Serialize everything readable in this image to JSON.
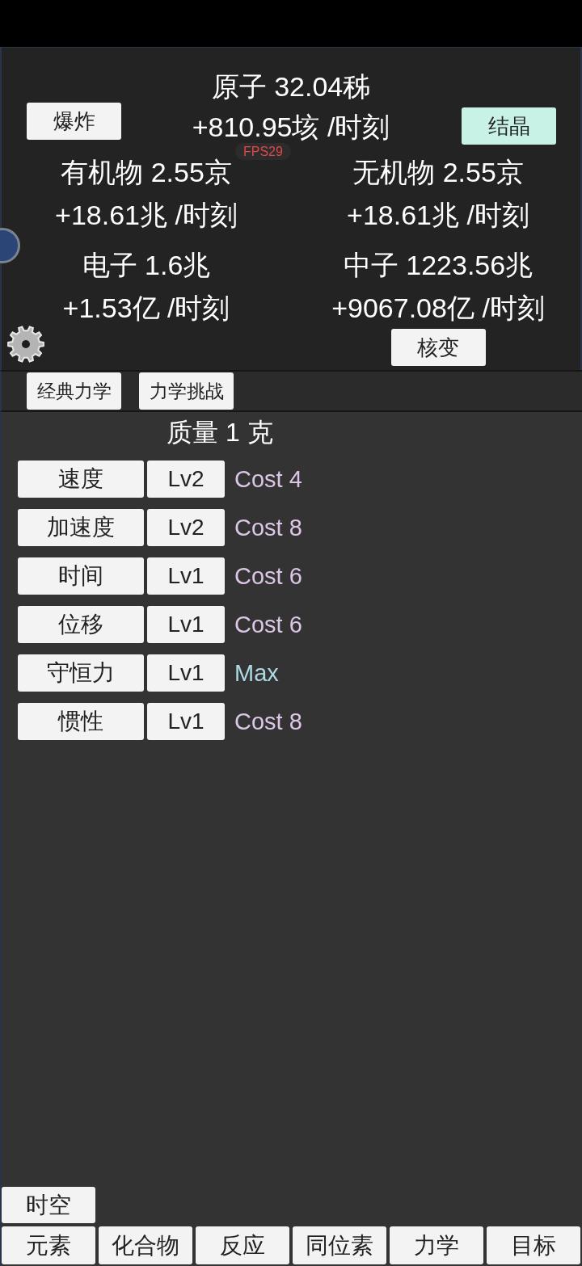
{
  "top_panel": {
    "explode_button": "爆炸",
    "atom": {
      "amount": "原子 32.04秭",
      "rate": "+810.95垓 /时刻"
    },
    "crystal_button": "结晶",
    "fps_counter": "FPS29",
    "resources": [
      {
        "amount": "有机物 2.55京",
        "rate": "+18.61兆 /时刻"
      },
      {
        "amount": "无机物 2.55京",
        "rate": "+18.61兆 /时刻"
      },
      {
        "amount": "电子 1.6兆",
        "rate": "+1.53亿 /时刻"
      },
      {
        "amount": "中子 1223.56兆",
        "rate": "+9067.08亿 /时刻"
      }
    ],
    "fission_button": "核变"
  },
  "subtabs": [
    {
      "label": "经典力学"
    },
    {
      "label": "力学挑战"
    }
  ],
  "mass_title": "质量 1 克",
  "upgrades": [
    {
      "name": "速度",
      "level": "Lv2",
      "kind": "cost",
      "price": "Cost 4"
    },
    {
      "name": "加速度",
      "level": "Lv2",
      "kind": "cost",
      "price": "Cost 8"
    },
    {
      "name": "时间",
      "level": "Lv1",
      "kind": "cost",
      "price": "Cost 6"
    },
    {
      "name": "位移",
      "level": "Lv1",
      "kind": "cost",
      "price": "Cost 6"
    },
    {
      "name": "守恒力",
      "level": "Lv1",
      "kind": "max",
      "price": "Max"
    },
    {
      "name": "惯性",
      "level": "Lv1",
      "kind": "cost",
      "price": "Cost 8"
    }
  ],
  "spacetime_button": "时空",
  "nav_tabs": [
    {
      "label": "元素"
    },
    {
      "label": "化合物"
    },
    {
      "label": "反应"
    },
    {
      "label": "同位素"
    },
    {
      "label": "力学"
    },
    {
      "label": "目标"
    }
  ]
}
